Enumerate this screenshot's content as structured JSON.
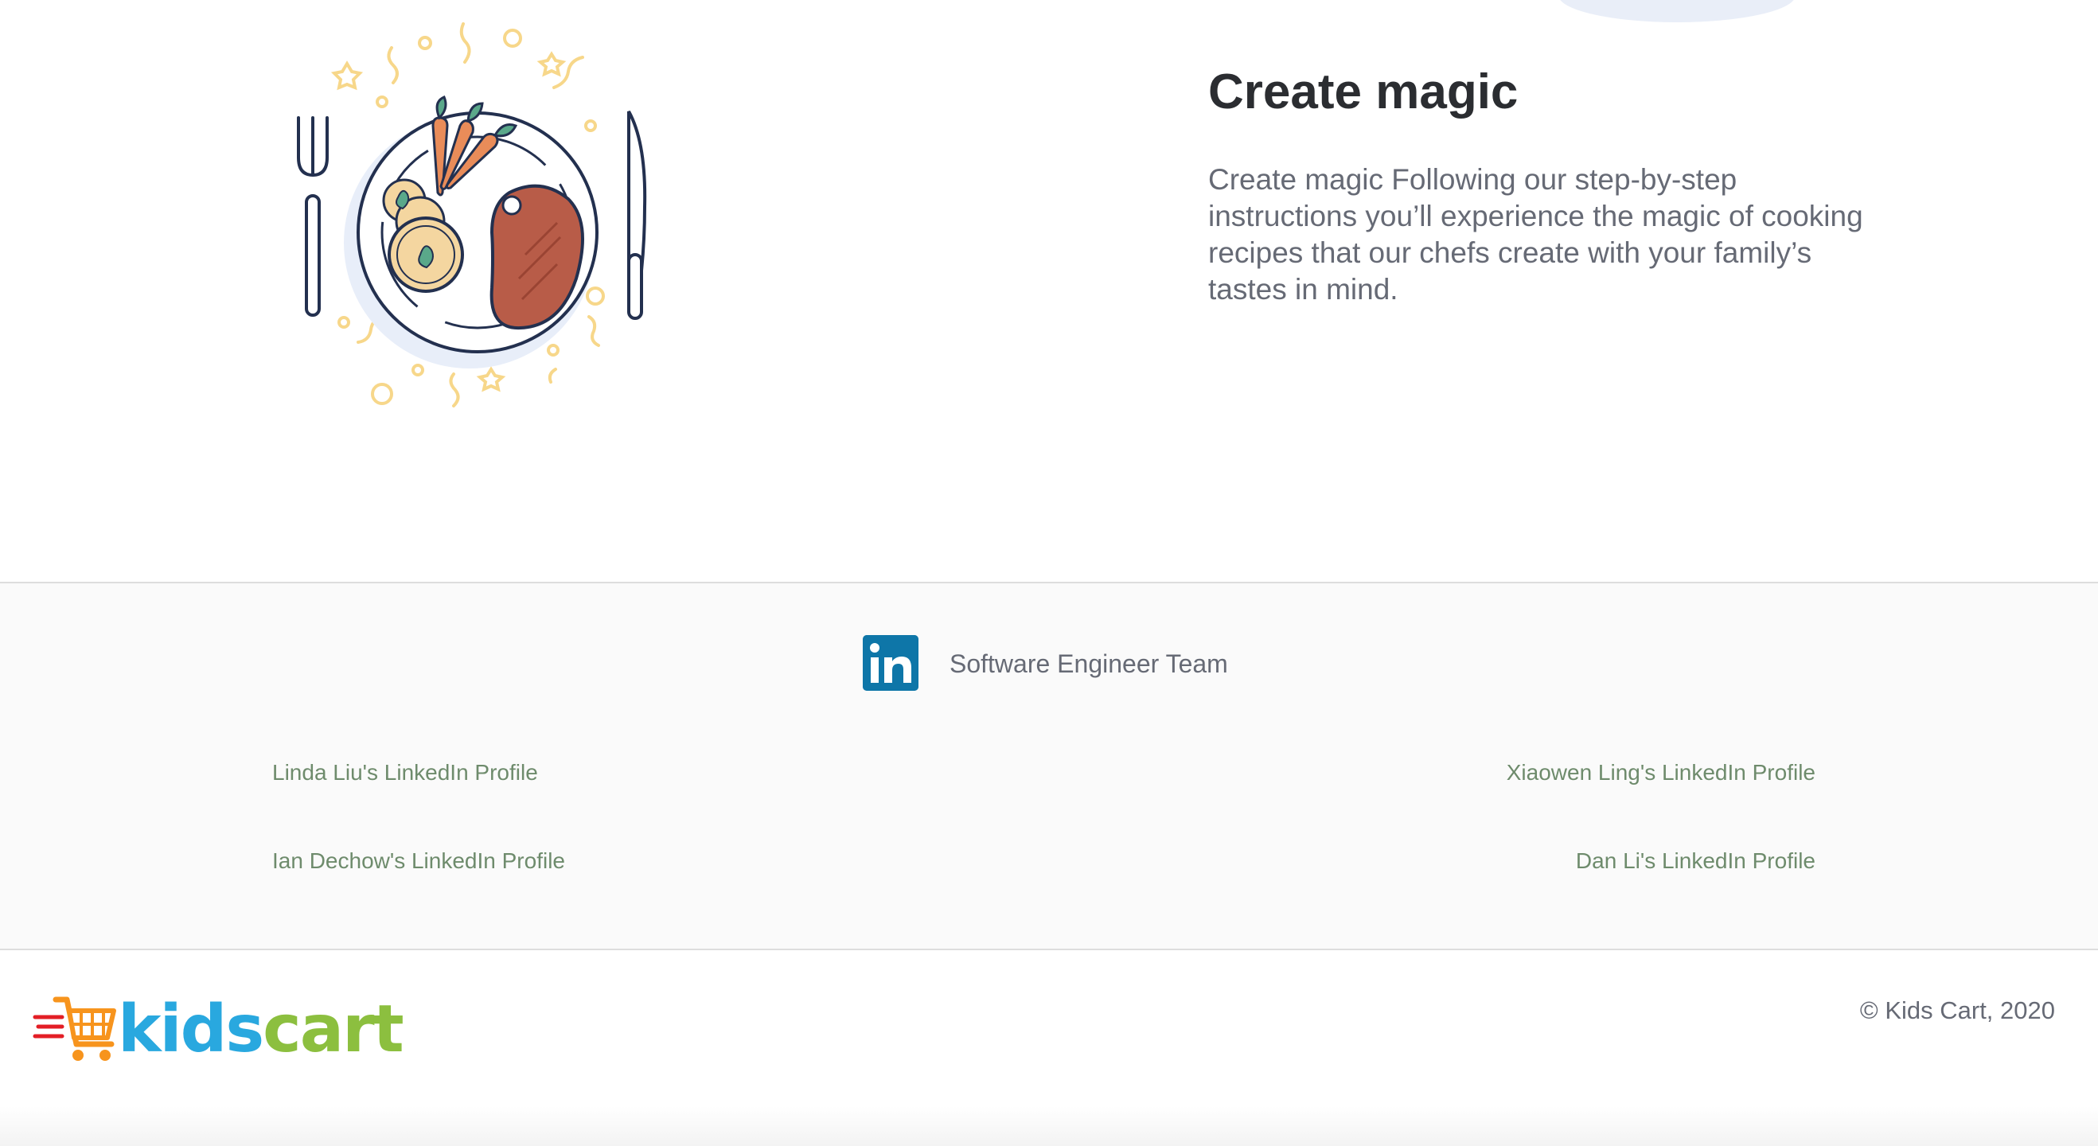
{
  "feature": {
    "title": "Create magic",
    "body": "Create magic Following our step-by-step instructions you’ll experience the magic of cooking recipes that our chefs create with your family’s tastes in mind."
  },
  "team": {
    "title": "Software Engineer Team",
    "links": [
      "Linda Liu's LinkedIn Profile",
      "Xiaowen Ling's LinkedIn Profile",
      "Ian Dechow's LinkedIn Profile",
      "Dan Li's LinkedIn Profile"
    ],
    "logo_text": "in"
  },
  "footer": {
    "brand_kids": "kids",
    "brand_cart": "cart",
    "copyright": "© Kids Cart, 2020"
  },
  "icons": {
    "illustration": "plate-meal-illustration",
    "linkedin": "linkedin-icon",
    "cart": "shopping-cart-icon"
  },
  "colors": {
    "linkedin_blue": "#0e76a8",
    "link_green": "#6e8b6c",
    "brand_blue": "#29a8df",
    "brand_green": "#8cbf3f",
    "brand_orange": "#f7941d",
    "brand_red": "#e31e25"
  }
}
